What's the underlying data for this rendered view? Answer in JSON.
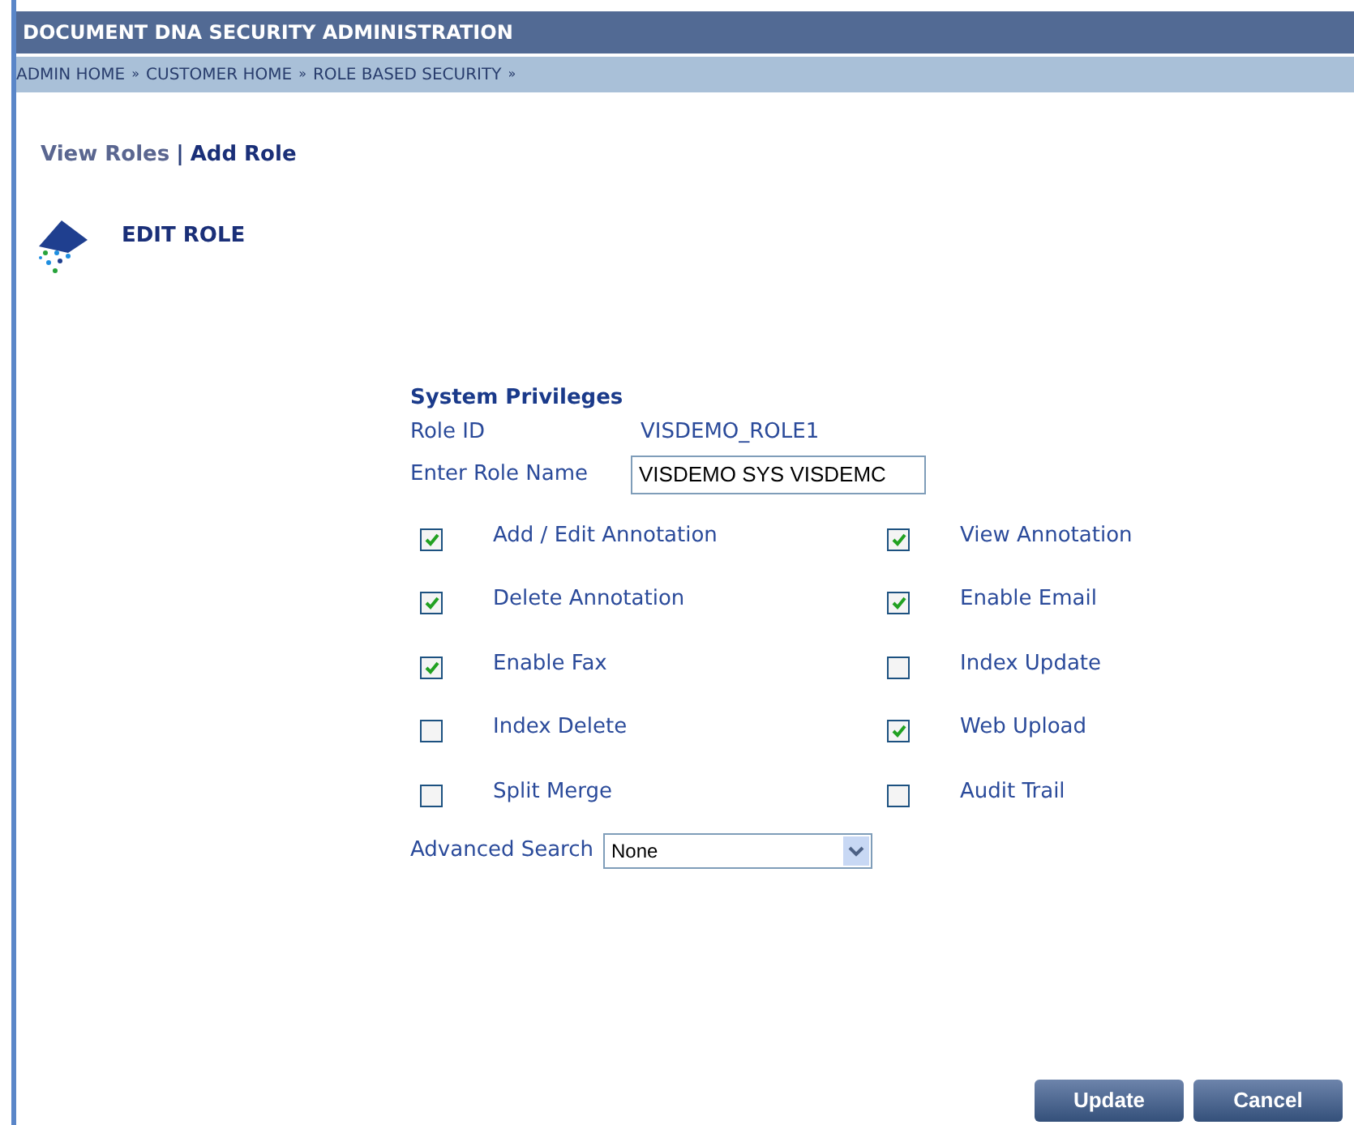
{
  "header": {
    "title": "DOCUMENT DNA SECURITY ADMINISTRATION"
  },
  "breadcrumb": [
    {
      "label": "ADMIN HOME",
      "separator": "»"
    },
    {
      "label": "CUSTOMER HOME",
      "separator": "»"
    },
    {
      "label": "ROLE BASED SECURITY",
      "separator": "»"
    }
  ],
  "nav": {
    "links": [
      {
        "label": "View Roles",
        "selected": false
      },
      {
        "label": "Add Role",
        "selected": true
      }
    ],
    "divider": "|"
  },
  "section_title": "EDIT ROLE",
  "form": {
    "heading": "System Privileges",
    "role_id_label": "Role ID",
    "role_id": "VISDEMO_ROLE1",
    "role_name_label": "Enter Role Name",
    "role_name": "VISDEMO SYS VISDEMC",
    "privileges": [
      {
        "label": "Add / Edit Annotation",
        "checked": true
      },
      {
        "label": "View Annotation",
        "checked": true
      },
      {
        "label": "Delete Annotation",
        "checked": true
      },
      {
        "label": "Enable Email",
        "checked": true
      },
      {
        "label": "Enable Fax",
        "checked": true
      },
      {
        "label": "Index Update",
        "checked": false
      },
      {
        "label": "Index Delete",
        "checked": false
      },
      {
        "label": "Web Upload",
        "checked": true
      },
      {
        "label": "Split Merge",
        "checked": false
      },
      {
        "label": "Audit Trail",
        "checked": false
      }
    ],
    "advanced_search_label": "Advanced Search",
    "advanced_search": "None"
  },
  "buttons": [
    "Update",
    "Cancel"
  ]
}
